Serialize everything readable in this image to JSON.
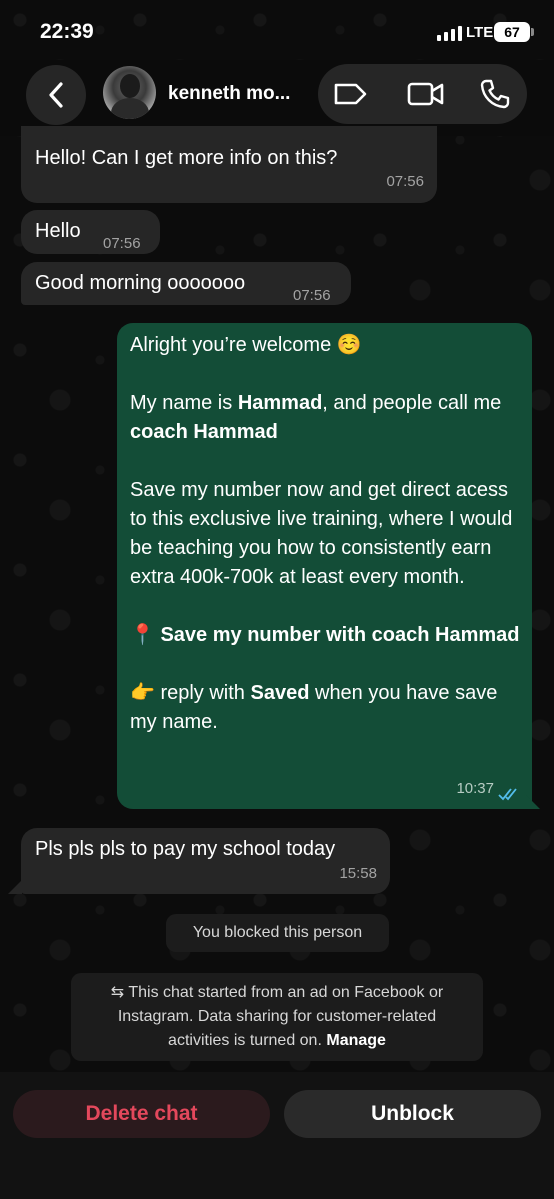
{
  "status_bar": {
    "time": "22:39",
    "network": "LTE",
    "battery": "67"
  },
  "header": {
    "contact_name": "kenneth mo...",
    "icons": [
      "back-icon",
      "label-icon",
      "video-call-icon",
      "voice-call-icon"
    ]
  },
  "messages": [
    {
      "direction": "in",
      "text": "Hello! Can I get more info on this?",
      "time": "07:56"
    },
    {
      "direction": "in",
      "text": "Hello",
      "time": "07:56"
    },
    {
      "direction": "in",
      "text": "Good morning ooooooo",
      "time": "07:56"
    },
    {
      "direction": "out",
      "time": "10:37",
      "read_status": "read",
      "lines": {
        "l1": "Alright you’re welcome ☺️",
        "l2a": "My name is ",
        "l2b": "Hammad",
        "l2c": ", and people call me ",
        "l2d": "coach Hammad",
        "l3": "Save my number now and get direct acess to this exclusive live training, where I would be teaching you how to consistently earn extra 400k-700k at least every month.",
        "l4a": "📍 ",
        "l4b": "Save my number with coach Hammad",
        "l5a": "👉 reply with ",
        "l5b": "Saved",
        "l5c": " when you have save my name."
      }
    },
    {
      "direction": "in",
      "text": "Pls pls pls to pay my school today",
      "time": "15:58"
    }
  ],
  "notices": {
    "blocked": "You blocked this person",
    "ad_notice_icon": "⇆",
    "ad_notice": "This chat started from an ad on Facebook or Instagram. Data sharing for customer-related activities is turned on.",
    "ad_notice_link": "Manage"
  },
  "actions": {
    "delete": "Delete chat",
    "unblock": "Unblock"
  },
  "colors": {
    "outgoing_bubble": "#134d37",
    "incoming_bubble": "#262626",
    "delete_text": "#e3485c",
    "read_ticks": "#53bdeb"
  }
}
